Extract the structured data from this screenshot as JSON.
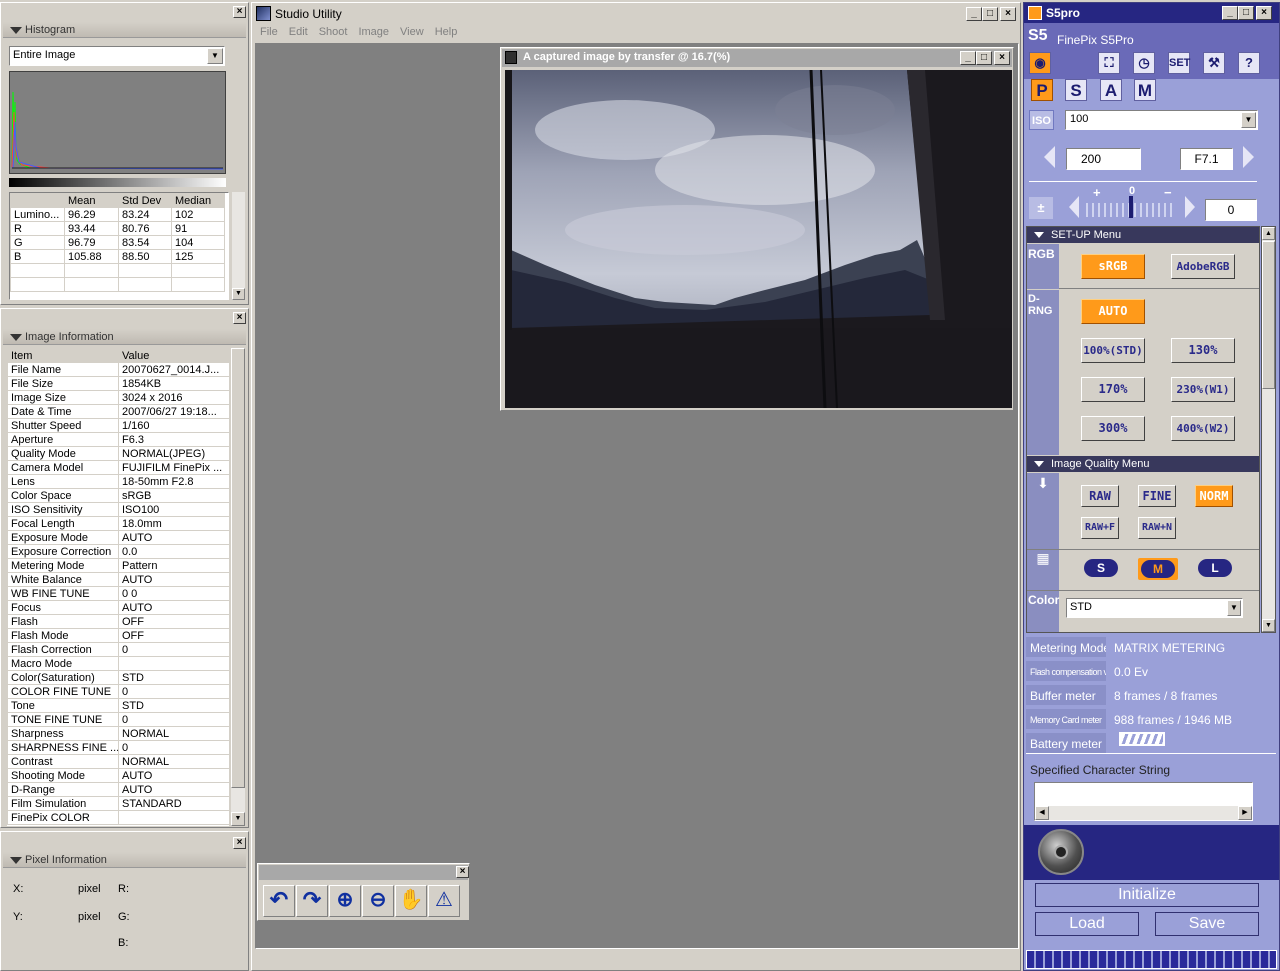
{
  "histogram": {
    "title": "Histogram",
    "select_value": "Entire Image",
    "headers": [
      "",
      "Mean",
      "Std Dev",
      "Median"
    ],
    "rows": [
      [
        "Lumino...",
        "96.29",
        "83.24",
        "102"
      ],
      [
        "R",
        "93.44",
        "80.76",
        "91"
      ],
      [
        "G",
        "96.79",
        "83.54",
        "104"
      ],
      [
        "B",
        "105.88",
        "88.50",
        "125"
      ]
    ]
  },
  "image_info": {
    "title": "Image Information",
    "headers": [
      "Item",
      "Value"
    ],
    "rows": [
      [
        "File Name",
        "20070627_0014.J..."
      ],
      [
        "File Size",
        "1854KB"
      ],
      [
        "Image Size",
        "3024 x 2016"
      ],
      [
        "Date & Time",
        "2007/06/27 19:18..."
      ],
      [
        "Shutter Speed",
        "1/160"
      ],
      [
        "Aperture",
        "F6.3"
      ],
      [
        "Quality Mode",
        "NORMAL(JPEG)"
      ],
      [
        "Camera Model",
        "FUJIFILM FinePix ..."
      ],
      [
        "Lens",
        "18-50mm F2.8"
      ],
      [
        "Color Space",
        "sRGB"
      ],
      [
        "ISO Sensitivity",
        "ISO100"
      ],
      [
        "Focal Length",
        "18.0mm"
      ],
      [
        "Exposure Mode",
        "AUTO"
      ],
      [
        "Exposure Correction",
        "0.0"
      ],
      [
        "Metering Mode",
        "Pattern"
      ],
      [
        "White Balance",
        "AUTO"
      ],
      [
        "WB FINE TUNE",
        "0 0"
      ],
      [
        "Focus",
        "AUTO"
      ],
      [
        "Flash",
        "OFF"
      ],
      [
        "Flash Mode",
        "OFF"
      ],
      [
        "Flash Correction",
        "0"
      ],
      [
        "Macro Mode",
        ""
      ],
      [
        "Color(Saturation)",
        "STD"
      ],
      [
        "COLOR FINE TUNE",
        "0"
      ],
      [
        "Tone",
        "STD"
      ],
      [
        "TONE FINE TUNE",
        "0"
      ],
      [
        "Sharpness",
        "NORMAL"
      ],
      [
        "SHARPNESS FINE ...",
        "0"
      ],
      [
        "Contrast",
        "NORMAL"
      ],
      [
        "Shooting Mode",
        "AUTO"
      ],
      [
        "D-Range",
        "AUTO"
      ],
      [
        "Film Simulation",
        "STANDARD"
      ],
      [
        "FinePix COLOR",
        ""
      ]
    ]
  },
  "pixel_info": {
    "title": "Pixel Information",
    "x_label": "X:",
    "y_label": "Y:",
    "pixel1": "pixel",
    "pixel2": "pixel",
    "r_label": "R:",
    "g_label": "G:",
    "b_label": "B:"
  },
  "studio": {
    "title": "Studio Utility",
    "menu": [
      "File",
      "Edit",
      "Shoot",
      "Image",
      "View",
      "Help"
    ],
    "image_window_title": "A captured image by transfer @ 16.7(%)"
  },
  "s5pro": {
    "window_title": "S5pro",
    "model": "FinePix S5Pro",
    "set_label": "SET",
    "help_label": "?",
    "modes": [
      "P",
      "S",
      "A",
      "M"
    ],
    "iso_label": "ISO",
    "iso_value": "100",
    "shutter": "200",
    "aperture": "F7.1",
    "ev_plus": "+",
    "ev_zero": "0",
    "ev_minus": "−",
    "ev_value": "0",
    "setup_menu": "SET-UP Menu",
    "rgb_label": "RGB",
    "srgb": "sRGB",
    "adobergb": "AdobeRGB",
    "drng_label": "D-RNG",
    "auto": "AUTO",
    "drange": [
      "100%(STD)",
      "130%",
      "170%",
      "230%(W1)",
      "300%",
      "400%(W2)"
    ],
    "quality_menu": "Image Quality Menu",
    "quality": [
      "RAW",
      "FINE",
      "NORM",
      "RAW+F",
      "RAW+N"
    ],
    "sizes": [
      "S",
      "M",
      "L"
    ],
    "color_label": "Color",
    "color_value": "STD",
    "status": [
      [
        "Metering Mode",
        "MATRIX METERING"
      ],
      [
        "Flash compensation value",
        "0.0 Ev"
      ],
      [
        "Buffer meter",
        "8 frames / 8 frames"
      ],
      [
        "Memory Card meter",
        "988 frames / 1946 MB"
      ],
      [
        "Battery meter",
        ""
      ]
    ],
    "char_string_label": "Specified Character String",
    "initialize": "Initialize",
    "load": "Load",
    "save": "Save"
  }
}
